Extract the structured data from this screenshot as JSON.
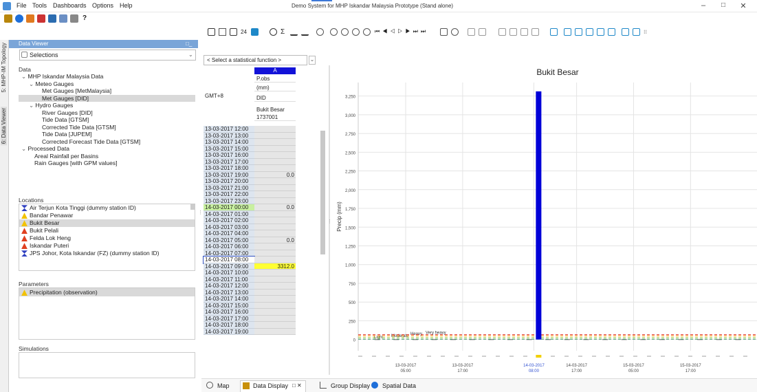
{
  "app": {
    "title": "Demo System for MHP Iskandar Malaysia Prototype  (Stand alone)",
    "menu": [
      "File",
      "Tools",
      "Dashboards",
      "Options",
      "Help"
    ]
  },
  "vertical_tabs": [
    "5: MHP-IM Topology",
    "6: Data Viewer"
  ],
  "data_viewer": {
    "header": "Data Viewer",
    "selection": "Selections"
  },
  "data_section": {
    "label": "Data",
    "tree": [
      {
        "label": "MHP Iskandar Malaysia Data",
        "level": 0,
        "expander": true
      },
      {
        "label": "Meteo Gauges",
        "level": 1,
        "expander": true
      },
      {
        "label": "Met Gauges [MetMalaysia]",
        "level": 2
      },
      {
        "label": "Met Gauges [DID]",
        "level": 2,
        "selected": true
      },
      {
        "label": "Hydro Gauges",
        "level": 1,
        "expander": true
      },
      {
        "label": "River Gauges [DID]",
        "level": 2
      },
      {
        "label": "Tide Data [GTSM]",
        "level": 2
      },
      {
        "label": "Corrected Tide Data [GTSM]",
        "level": 2
      },
      {
        "label": "Tide Data [JUPEM]",
        "level": 2
      },
      {
        "label": "Corrected Forecast Tide Data [GTSM]",
        "level": 2
      },
      {
        "label": "Processed Data",
        "level": 0,
        "expander": true
      },
      {
        "label": "Areal Rainfall per Basins",
        "level": 1
      },
      {
        "label": "Rain Gauges [with GPM values]",
        "level": 1
      }
    ]
  },
  "locations": {
    "label": "Locations",
    "items": [
      {
        "label": "Air Terjun Kota Tinggi (dummy station ID)",
        "icon": "hourglass-icon"
      },
      {
        "label": "Bandar Penawar",
        "icon": "warning-icon"
      },
      {
        "label": "Bukit Besar",
        "icon": "warning-icon",
        "selected": true
      },
      {
        "label": "Bukit Pelali",
        "icon": "alarm-triangle-icon"
      },
      {
        "label": "Felda Lok Heng",
        "icon": "alarm-triangle-icon"
      },
      {
        "label": "Iskandar Puteri",
        "icon": "alarm-triangle-icon"
      },
      {
        "label": "JPS Johor, Kota Iskandar (FZ) (dummy station ID)",
        "icon": "hourglass-icon"
      }
    ]
  },
  "parameters": {
    "label": "Parameters",
    "items": [
      {
        "label": "Precipitation (observation)",
        "icon": "warning-icon"
      }
    ]
  },
  "simulations": {
    "label": "Simulations"
  },
  "table": {
    "stat_placeholder": "< Select a statistical function >",
    "column_letter": "A",
    "col_param": "P.obs",
    "col_unit": "(mm)",
    "col_source": "DID",
    "col_location": "Bukit Besar",
    "col_id": "1737001",
    "timezone": "GMT+8",
    "rows": [
      {
        "t": "13-03-2017 12:00",
        "v": ""
      },
      {
        "t": "13-03-2017 13:00",
        "v": ""
      },
      {
        "t": "13-03-2017 14:00",
        "v": ""
      },
      {
        "t": "13-03-2017 15:00",
        "v": ""
      },
      {
        "t": "13-03-2017 16:00",
        "v": ""
      },
      {
        "t": "13-03-2017 17:00",
        "v": ""
      },
      {
        "t": "13-03-2017 18:00",
        "v": ""
      },
      {
        "t": "13-03-2017 19:00",
        "v": "0.0"
      },
      {
        "t": "13-03-2017 20:00",
        "v": ""
      },
      {
        "t": "13-03-2017 21:00",
        "v": ""
      },
      {
        "t": "13-03-2017 22:00",
        "v": ""
      },
      {
        "t": "13-03-2017 23:00",
        "v": ""
      },
      {
        "t": "14-03-2017 00:00",
        "v": "0.0",
        "hl": "green"
      },
      {
        "t": "14-03-2017 01:00",
        "v": ""
      },
      {
        "t": "14-03-2017 02:00",
        "v": ""
      },
      {
        "t": "14-03-2017 03:00",
        "v": ""
      },
      {
        "t": "14-03-2017 04:00",
        "v": ""
      },
      {
        "t": "14-03-2017 05:00",
        "v": "0.0"
      },
      {
        "t": "14-03-2017 06:00",
        "v": ""
      },
      {
        "t": "14-03-2017 07:00",
        "v": ""
      },
      {
        "t": "14-03-2017 08:00",
        "v": "",
        "hl": "focus"
      },
      {
        "t": "14-03-2017 09:00",
        "v": "3312.0",
        "hl": "yellow"
      },
      {
        "t": "14-03-2017 10:00",
        "v": ""
      },
      {
        "t": "14-03-2017 11:00",
        "v": ""
      },
      {
        "t": "14-03-2017 12:00",
        "v": ""
      },
      {
        "t": "14-03-2017 13:00",
        "v": ""
      },
      {
        "t": "14-03-2017 14:00",
        "v": ""
      },
      {
        "t": "14-03-2017 15:00",
        "v": ""
      },
      {
        "t": "14-03-2017 16:00",
        "v": ""
      },
      {
        "t": "14-03-2017 17:00",
        "v": ""
      },
      {
        "t": "14-03-2017 18:00",
        "v": ""
      },
      {
        "t": "14-03-2017 19:00",
        "v": ""
      }
    ]
  },
  "chart_data": {
    "type": "bar",
    "title": "Bukit Besar",
    "ylabel": "Precip (mm)",
    "ylim": [
      -150,
      3430
    ],
    "yticks": [
      0,
      250,
      500,
      750,
      1000,
      1250,
      1500,
      1750,
      2000,
      2250,
      2500,
      2750,
      3000,
      3250
    ],
    "ytick_labels": [
      "0",
      "250",
      "500",
      "750",
      "1,000",
      "1,250",
      "1,500",
      "1,750",
      "2,000",
      "2,250",
      "2,500",
      "2,750",
      "3,000",
      "3,250"
    ],
    "xticks": [
      {
        "line1": "13-03-2017",
        "line2": "05:00",
        "h": -28
      },
      {
        "line1": "13-03-2017",
        "line2": "17:00",
        "h": -16
      },
      {
        "line1": "14-03-2017",
        "line2": "08:00",
        "h": -1,
        "highlight": true
      },
      {
        "line1": "14-03-2017",
        "line2": "17:00",
        "h": 8
      },
      {
        "line1": "15-03-2017",
        "line2": "05:00",
        "h": 20
      },
      {
        "line1": "15-03-2017",
        "line2": "17:00",
        "h": 32
      }
    ],
    "xlim_hours": [
      -38,
      46
    ],
    "bars": [
      {
        "h": 0,
        "value": 3312.0
      }
    ],
    "thresholds": [
      {
        "label": "Light",
        "value": 5,
        "color": "#2e8b57"
      },
      {
        "label": "Moderate",
        "value": 25,
        "color": "#9acd32"
      },
      {
        "label": "Heavy",
        "value": 50,
        "color": "#ff8c00"
      },
      {
        "label": "Very heavy",
        "value": 65,
        "color": "#e03030"
      }
    ],
    "grid": true,
    "accent": "#0000d8"
  },
  "bottom_tabs": [
    "Map",
    "Data Display",
    "Group Display",
    "Spatial Data"
  ]
}
